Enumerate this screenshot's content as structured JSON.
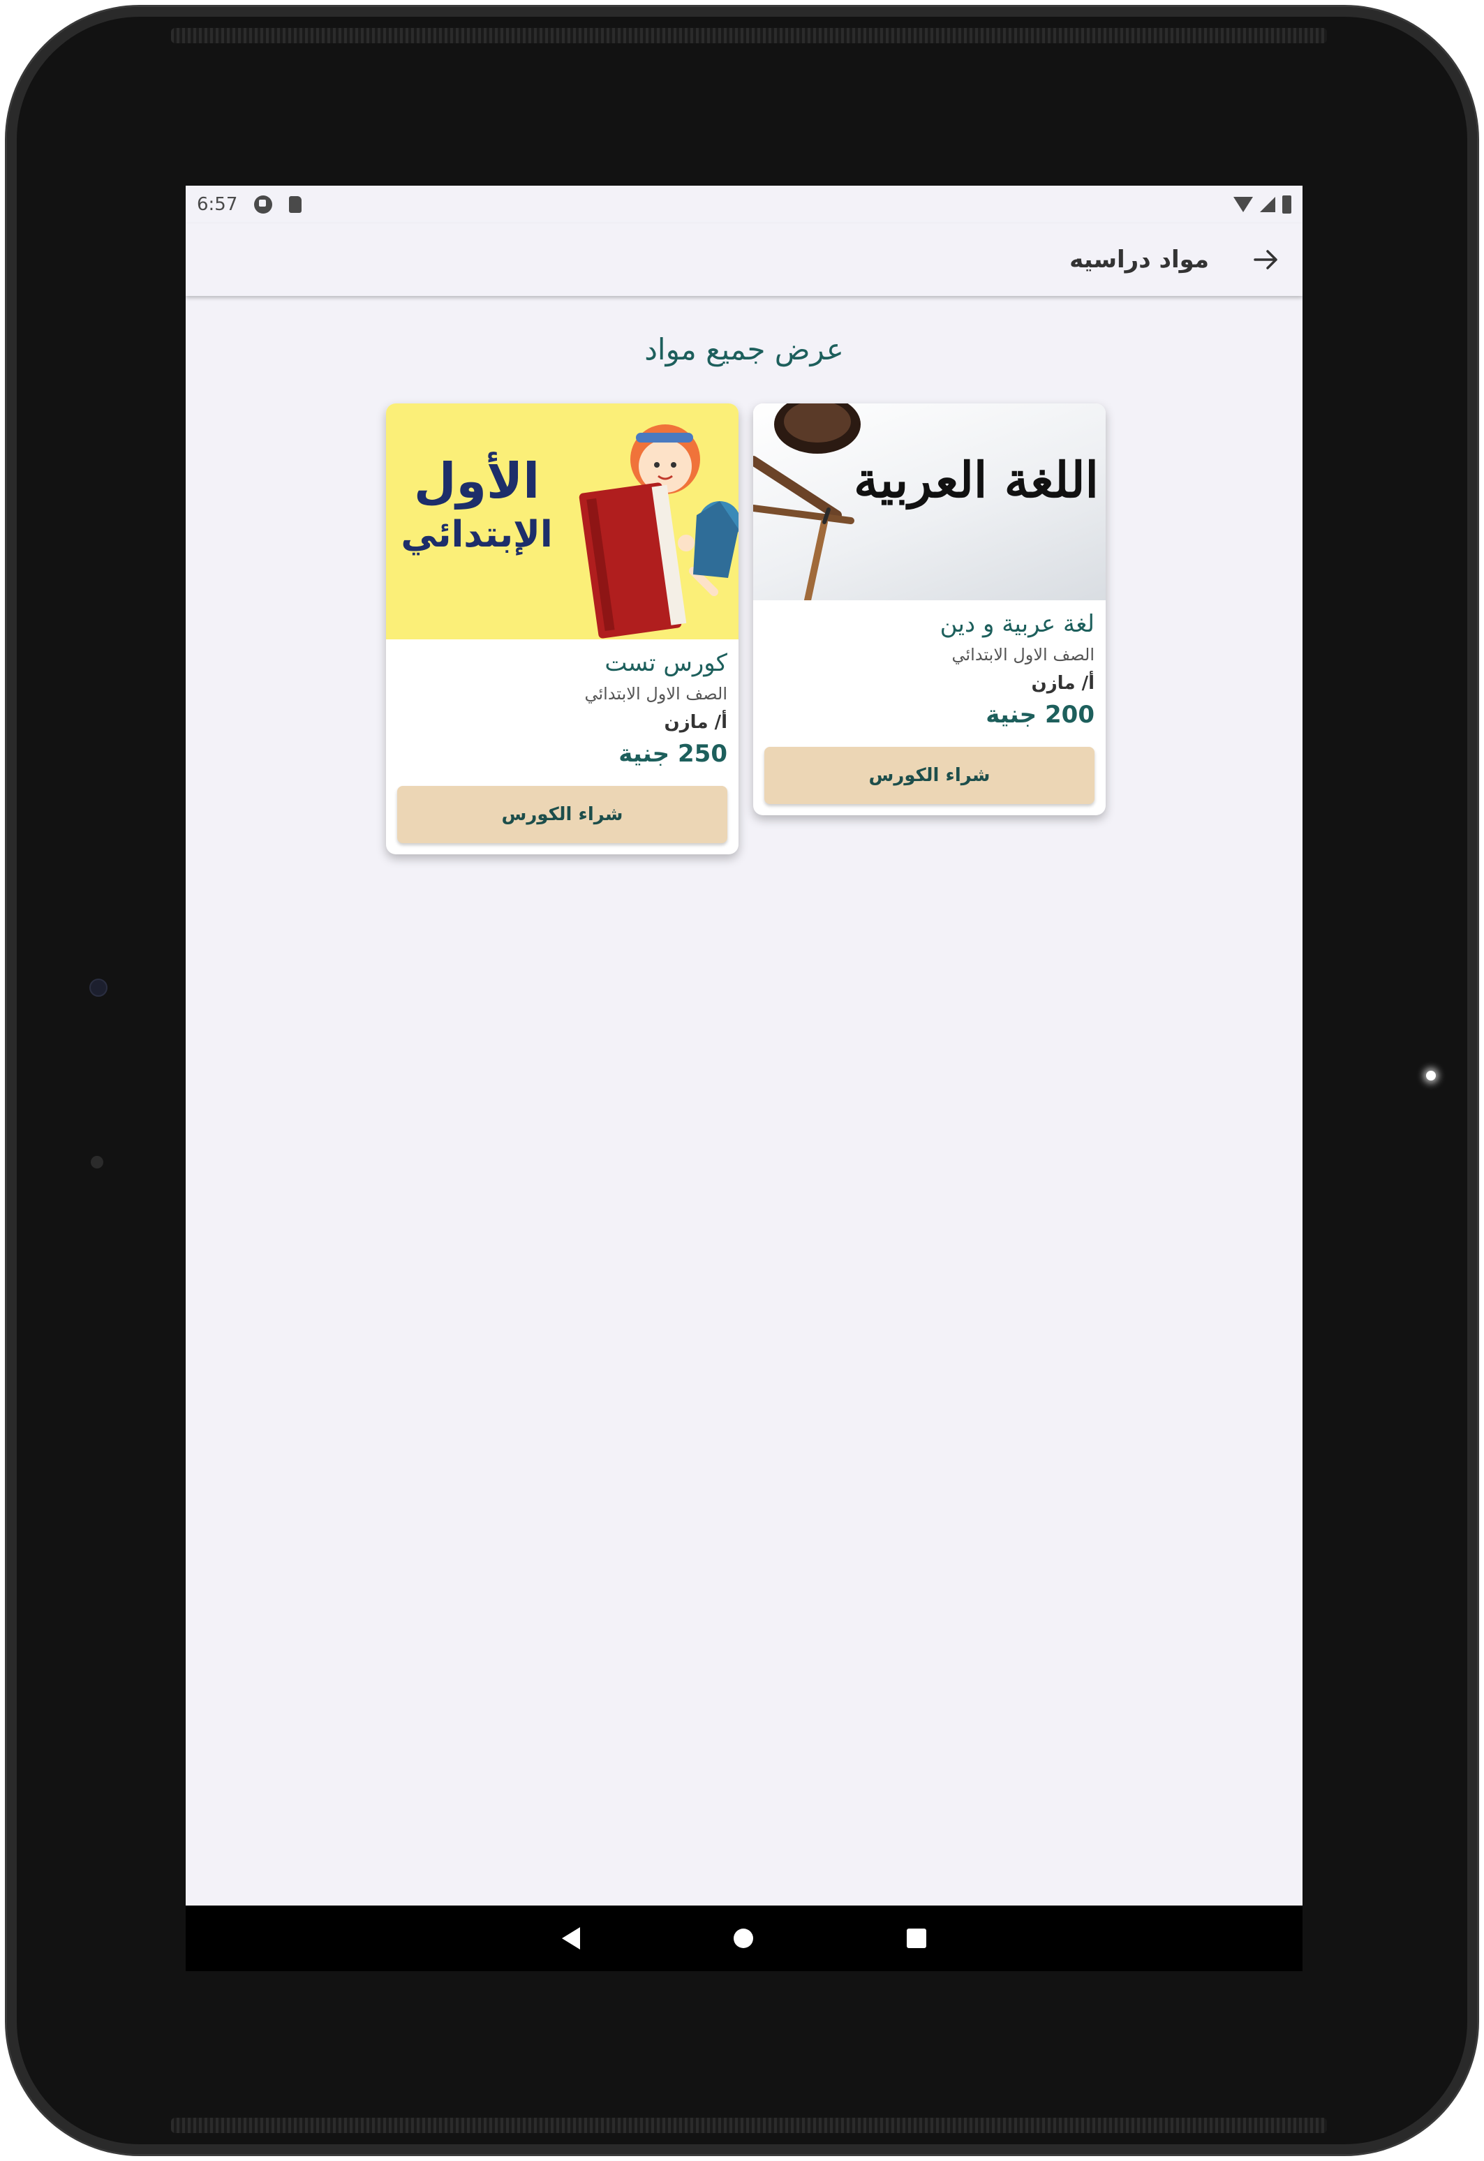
{
  "statusbar": {
    "time": "6:57"
  },
  "appbar": {
    "title": "مواد دراسيه"
  },
  "section_title": "عرض جميع مواد",
  "courses": [
    {
      "image_text": "اللغة العربية",
      "title": "لغة عربية و دين",
      "grade": "الصف الاول الابتدائي",
      "teacher": "أ/ مازن",
      "price": "200 جنية",
      "button": "شراء الكورس"
    },
    {
      "image_text": [
        "الأول",
        "الإبتدائي"
      ],
      "title": "كورس تست",
      "grade": "الصف الاول الابتدائي",
      "teacher": "أ/ مازن",
      "price": "250 جنية",
      "button": "شراء الكورس"
    }
  ],
  "colors": {
    "accent": "#1d5f5c",
    "button_bg": "#ecd6b5",
    "screen_bg": "#f3f2f8"
  },
  "icons": [
    "back-arrow-icon",
    "nav-back-icon",
    "nav-home-icon",
    "nav-recents-icon"
  ]
}
